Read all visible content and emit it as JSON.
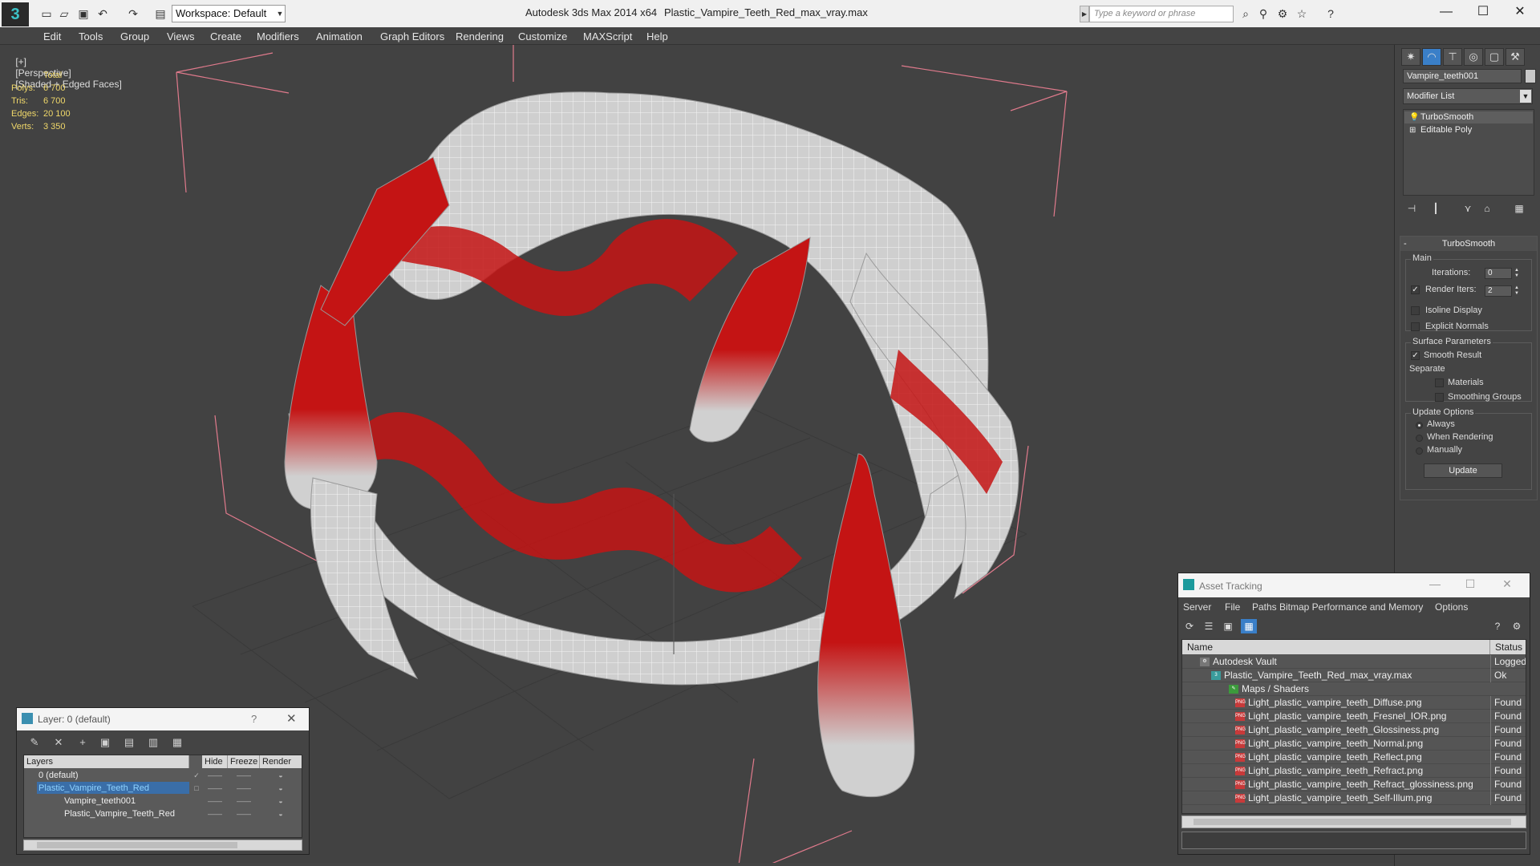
{
  "titlebar": {
    "app_title": "Autodesk 3ds Max  2014 x64",
    "file_name": "Plastic_Vampire_Teeth_Red_max_vray.max",
    "workspace": "Workspace: Default",
    "search_placeholder": "Type a keyword or phrase",
    "win_minimize": "—",
    "win_maximize": "☐",
    "win_close": "✕"
  },
  "menu": [
    "Edit",
    "Tools",
    "Group",
    "Views",
    "Create",
    "Modifiers",
    "Animation",
    "Graph Editors",
    "Rendering",
    "Customize",
    "MAXScript",
    "Help"
  ],
  "viewport": {
    "label_plus": "[+]",
    "label_view": "[Perspective]",
    "label_shading": "[Shaded + Edged Faces]",
    "stats": {
      "header": "Total",
      "rows": [
        {
          "key": "Polys:",
          "value": "6 700"
        },
        {
          "key": "Tris:",
          "value": "6 700"
        },
        {
          "key": "Edges:",
          "value": "20 100"
        },
        {
          "key": "Verts:",
          "value": "3 350"
        }
      ]
    },
    "colors": {
      "background": "#424242",
      "mesh": "#cfcfcf",
      "red": "#c41414",
      "bbox": "#e07a8c"
    }
  },
  "command_panel": {
    "object_name": "Vampire_teeth001",
    "modifier_list": "Modifier List",
    "stack": [
      "TurboSmooth",
      "Editable Poly"
    ],
    "turbosmooth": {
      "title": "TurboSmooth",
      "main_group": "Main",
      "iterations_label": "Iterations:",
      "iterations_value": "0",
      "render_iters_label": "Render Iters:",
      "render_iters_value": "2",
      "isoline": "Isoline Display",
      "explicit_normals": "Explicit Normals",
      "surface_group": "Surface Parameters",
      "smooth_result": "Smooth Result",
      "separate": "Separate",
      "materials": "Materials",
      "smoothing_groups": "Smoothing Groups",
      "update_group": "Update Options",
      "always": "Always",
      "when_rendering": "When Rendering",
      "manually": "Manually",
      "update_button": "Update"
    }
  },
  "layer_window": {
    "title": "Layer: 0 (default)",
    "help": "?",
    "close": "✕",
    "columns": [
      "Layers",
      "Hide",
      "Freeze",
      "Render"
    ],
    "rows": [
      {
        "name": "0 (default)"
      },
      {
        "name": "Plastic_Vampire_Teeth_Red"
      },
      {
        "name": "Vampire_teeth001"
      },
      {
        "name": "Plastic_Vampire_Teeth_Red"
      }
    ]
  },
  "asset_tracking": {
    "title": "Asset Tracking",
    "menu": [
      "Server",
      "File",
      "Paths",
      "Bitmap Performance and Memory",
      "Options"
    ],
    "columns": [
      "Name",
      "Status"
    ],
    "rows": [
      {
        "name": "Autodesk Vault",
        "status": "Logged"
      },
      {
        "name": "Plastic_Vampire_Teeth_Red_max_vray.max",
        "status": "Ok"
      },
      {
        "name": "Maps / Shaders",
        "status": ""
      },
      {
        "name": "Light_plastic_vampire_teeth_Diffuse.png",
        "status": "Found"
      },
      {
        "name": "Light_plastic_vampire_teeth_Fresnel_IOR.png",
        "status": "Found"
      },
      {
        "name": "Light_plastic_vampire_teeth_Glossiness.png",
        "status": "Found"
      },
      {
        "name": "Light_plastic_vampire_teeth_Normal.png",
        "status": "Found"
      },
      {
        "name": "Light_plastic_vampire_teeth_Reflect.png",
        "status": "Found"
      },
      {
        "name": "Light_plastic_vampire_teeth_Refract.png",
        "status": "Found"
      },
      {
        "name": "Light_plastic_vampire_teeth_Refract_glossiness.png",
        "status": "Found"
      },
      {
        "name": "Light_plastic_vampire_teeth_Self-Illum.png",
        "status": "Found"
      }
    ],
    "png_tag": "PNG"
  }
}
